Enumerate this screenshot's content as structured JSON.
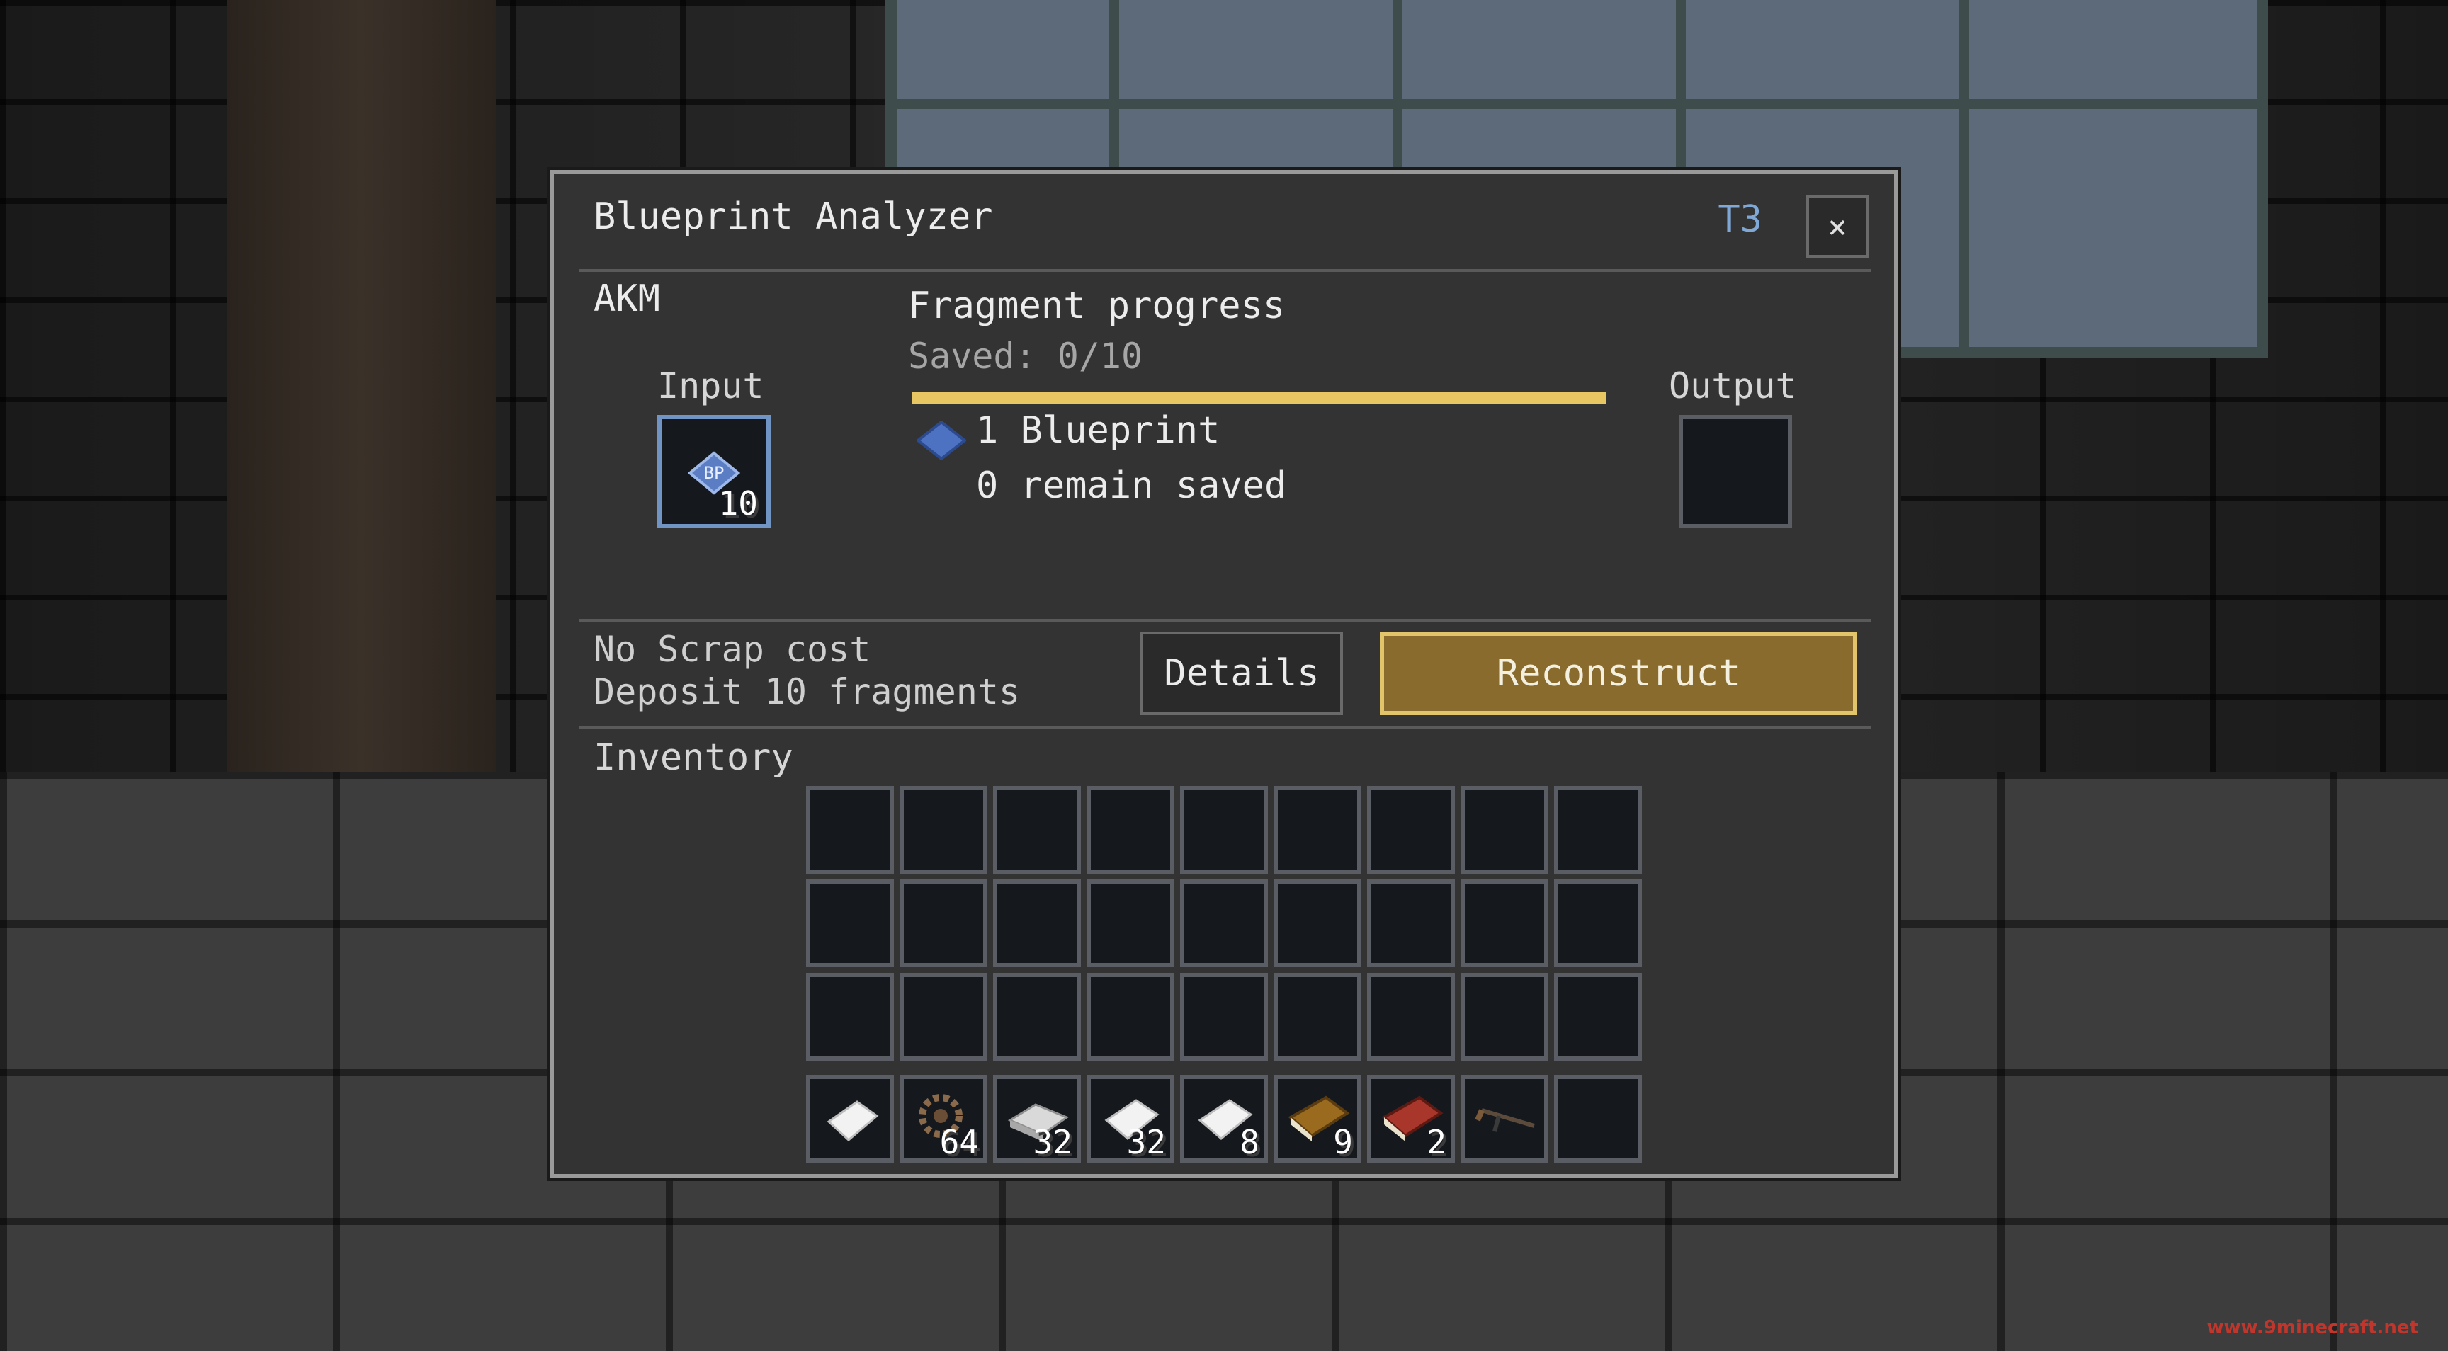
{
  "window": {
    "title": "Blueprint Analyzer",
    "tier": "T3",
    "close_label": "×"
  },
  "item_name": "AKM",
  "input": {
    "label": "Input",
    "item_icon": "blueprint-icon",
    "icon_text": "BP",
    "count": "10"
  },
  "output": {
    "label": "Output"
  },
  "progress": {
    "title": "Fragment progress",
    "saved": "Saved: 0/10",
    "fill_fraction": 1.0,
    "blueprint_line": "1 Blueprint",
    "remain_line": "0 remain saved"
  },
  "cost": {
    "line1": "No Scrap cost",
    "line2": "Deposit 10 fragments"
  },
  "buttons": {
    "details": "Details",
    "reconstruct": "Reconstruct"
  },
  "inventory": {
    "label": "Inventory",
    "hotbar": [
      {
        "icon": "paper-icon",
        "count": ""
      },
      {
        "icon": "gear-icon",
        "count": "64"
      },
      {
        "icon": "iron-ingot-icon",
        "count": "32"
      },
      {
        "icon": "paper-icon",
        "count": "32"
      },
      {
        "icon": "paper-icon",
        "count": "8"
      },
      {
        "icon": "brown-book-icon",
        "count": "9"
      },
      {
        "icon": "red-book-icon",
        "count": "2"
      },
      {
        "icon": "rifle-icon",
        "count": ""
      },
      {
        "icon": "",
        "count": ""
      }
    ]
  },
  "colors": {
    "accent_tier": "#7fa8d6",
    "progress_fill": "#e8c662",
    "reconstruct_bg": "#8a6b2e",
    "reconstruct_border": "#e2c46a",
    "input_slot_border": "#7094c4"
  },
  "watermark": "www.9minecraft.net"
}
